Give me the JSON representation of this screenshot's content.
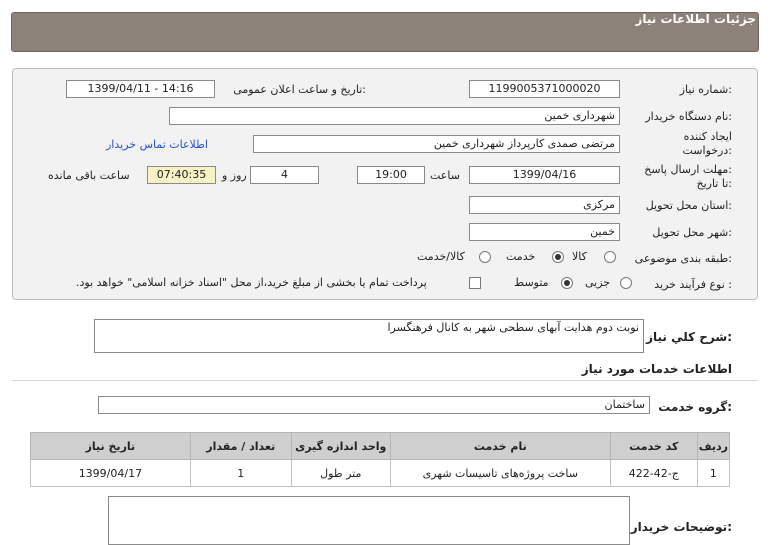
{
  "header": {
    "title": "جزئیات اطلاعات نیاز"
  },
  "form": {
    "need_number_label": "شماره نیاز:",
    "need_number": "1199005371000020",
    "announce_label": "تاریخ و ساعت اعلان عمومی:",
    "announce_value": "1399/04/11 - 14:16",
    "buyer_org_label": "نام دستگاه خریدار:",
    "buyer_org": "شهرداری خمین",
    "creator_label_1": "ایجاد کننده",
    "creator_label_2": "درخواست:",
    "creator": "مرتضی صمدی کارپرداز شهرداری خمین",
    "contact_link": "اطلاعات تماس خریدار",
    "deadline_label_1": "مهلت ارسال پاسخ:",
    "deadline_label_2": "تا تاریخ:",
    "deadline_date": "1399/04/16",
    "time_label": "ساعت",
    "deadline_time": "19:00",
    "days_value": "4",
    "days_label": "روز و",
    "remaining_time": "07:40:35",
    "remaining_label": "ساعت باقی مانده",
    "province_label": "استان محل تحویل:",
    "province": "مرکزی",
    "city_label": "شهر محل تحویل:",
    "city": "خمین",
    "category_label": "طبقه بندی موضوعی:",
    "category_options": [
      "کالا",
      "خدمت",
      "کالا/خدمت"
    ],
    "category_selected": "خدمت",
    "process_label": "نوع فرآیند خرید :",
    "process_options": [
      "جزیی",
      "متوسط"
    ],
    "process_selected": "متوسط",
    "payment_note": "پرداخت تمام یا بخشی از مبلغ خرید،از محل \"اسناد خزانه اسلامی\" خواهد بود."
  },
  "description": {
    "label": "شرح کلي نياز:",
    "value": "نوبت دوم هدایت آبهای سطحی شهر به کانال فرهنگسرا"
  },
  "services": {
    "section_title": "اطلاعات خدمات مورد نیاز",
    "group_label": "گروه خدمت:",
    "group_value": "ساختمان",
    "columns": [
      "ردیف",
      "کد خدمت",
      "نام خدمت",
      "واحد اندازه گیری",
      "تعداد / مقدار",
      "تاریخ نیاز"
    ],
    "rows": [
      [
        "1",
        "ج-42-422",
        "ساخت پروژه‌های تاسیسات شهری",
        "متر طول",
        "1",
        "1399/04/17"
      ]
    ]
  },
  "buyer_notes": {
    "label": "توضیحات خریدار:",
    "value": ""
  }
}
